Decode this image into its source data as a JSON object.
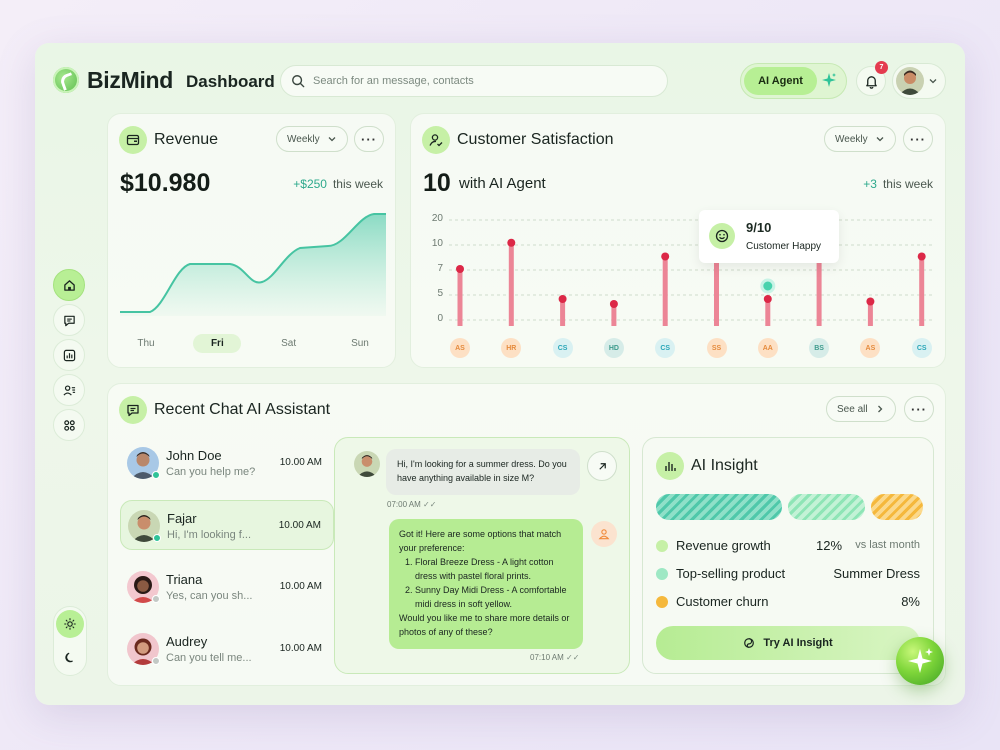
{
  "app": {
    "brand": "BizMind",
    "page_title": "Dashboard"
  },
  "search": {
    "placeholder": "Search for an message, contacts"
  },
  "header": {
    "ai_agent_label": "AI Agent",
    "notifications_count": "7"
  },
  "revenue": {
    "title": "Revenue",
    "period": "Weekly",
    "value": "$10.980",
    "delta": "+$250",
    "delta_suffix": "this week",
    "days": [
      "Thu",
      "Fri",
      "Sat",
      "Sun"
    ],
    "active_day": "Fri"
  },
  "satisfaction": {
    "title": "Customer Satisfaction",
    "period": "Weekly",
    "value": "10",
    "value_suffix": "with AI Agent",
    "delta": "+3",
    "delta_suffix": "this week",
    "tooltip_value": "9/10",
    "tooltip_label": "Customer Happy"
  },
  "chart_data": {
    "type": "bar",
    "yticks": [
      "20",
      "10",
      "7",
      "5",
      "0"
    ],
    "categories": [
      "AS",
      "HR",
      "CS",
      "HD",
      "CS",
      "SS",
      "AA",
      "BS",
      "AS",
      "CS"
    ],
    "values": [
      7,
      10.5,
      4,
      3,
      8.5,
      9,
      4,
      9,
      3.5,
      8.5
    ],
    "highlight_index": 6,
    "colors": {
      "bar": "#ec8596",
      "cap": "#dc2847",
      "highlight": "#49d2ad"
    }
  },
  "chat": {
    "title": "Recent Chat AI Assistant",
    "see_all": "See all",
    "contacts": [
      {
        "name": "John Doe",
        "message": "Can you help me?",
        "time": "10.00 AM"
      },
      {
        "name": "Fajar",
        "message": "Hi, I'm looking f...",
        "time": "10.00 AM"
      },
      {
        "name": "Triana",
        "message": "Yes, can you sh...",
        "time": "10.00 AM"
      },
      {
        "name": "Audrey",
        "message": "Can you tell me...",
        "time": "10.00 AM"
      }
    ],
    "incoming": "Hi, I'm looking for a summer dress. Do you have anything available in size M?",
    "incoming_time": "07:00 AM",
    "reply_intro": "Got it! Here are some options that match your preference:",
    "reply_items": [
      "Floral Breeze Dress - A light cotton dress with pastel floral prints.",
      "Sunny Day Midi Dress - A comfortable midi dress in soft yellow."
    ],
    "reply_outro": "Would you like me to share more details or photos of any of these?",
    "reply_time": "07:10 AM"
  },
  "insight": {
    "title": "AI Insight",
    "rows": [
      {
        "label": "Revenue growth",
        "value": "12%",
        "suffix": "vs last month"
      },
      {
        "label": "Top-selling product",
        "value": "Summer Dress",
        "suffix": ""
      },
      {
        "label": "Customer churn",
        "value": "8%",
        "suffix": ""
      }
    ],
    "button": "Try AI Insight"
  }
}
